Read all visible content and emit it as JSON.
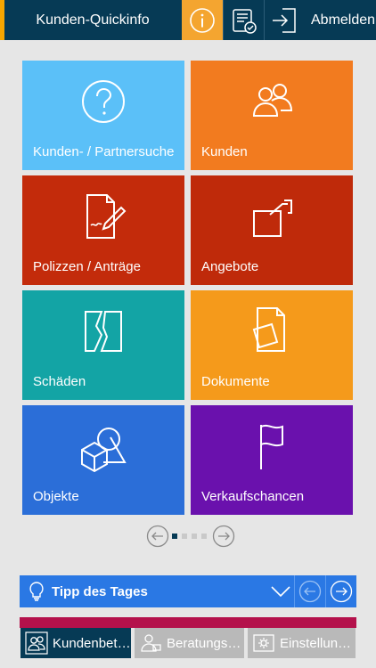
{
  "header": {
    "title": "Kunden-Quickinfo",
    "logout_label": "Abmelden"
  },
  "tiles": [
    {
      "label": "Kunden- / Partnersuche",
      "color": "#5bc0f8",
      "icon": "question-icon"
    },
    {
      "label": "Kunden",
      "color": "#f27b1f",
      "icon": "people-icon"
    },
    {
      "label": "Polizzen / Anträge",
      "color": "#c32b0b",
      "icon": "signature-document-icon"
    },
    {
      "label": "Angebote",
      "color": "#bf2a0a",
      "icon": "offer-hand-icon"
    },
    {
      "label": "Schäden",
      "color": "#13a4a5",
      "icon": "broken-frame-icon"
    },
    {
      "label": "Dokumente",
      "color": "#f59a1b",
      "icon": "documents-icon"
    },
    {
      "label": "Objekte",
      "color": "#2b6ed8",
      "icon": "shapes-icon"
    },
    {
      "label": "Verkaufschancen",
      "color": "#6a11ad",
      "icon": "flag-icon"
    }
  ],
  "pager": {
    "pages": 4,
    "current": 1
  },
  "tipp": {
    "label": "Tipp des Tages"
  },
  "bottom_tabs": [
    {
      "label": "Kundenbet…",
      "active": true
    },
    {
      "label": "Beratungs…",
      "active": false
    },
    {
      "label": "Einstellun…",
      "active": false
    }
  ],
  "colors": {
    "header_bg": "#063a55",
    "accent_orange": "#f4a530",
    "tipp_blue": "#2a78e4",
    "strip_red": "#b4114b"
  }
}
